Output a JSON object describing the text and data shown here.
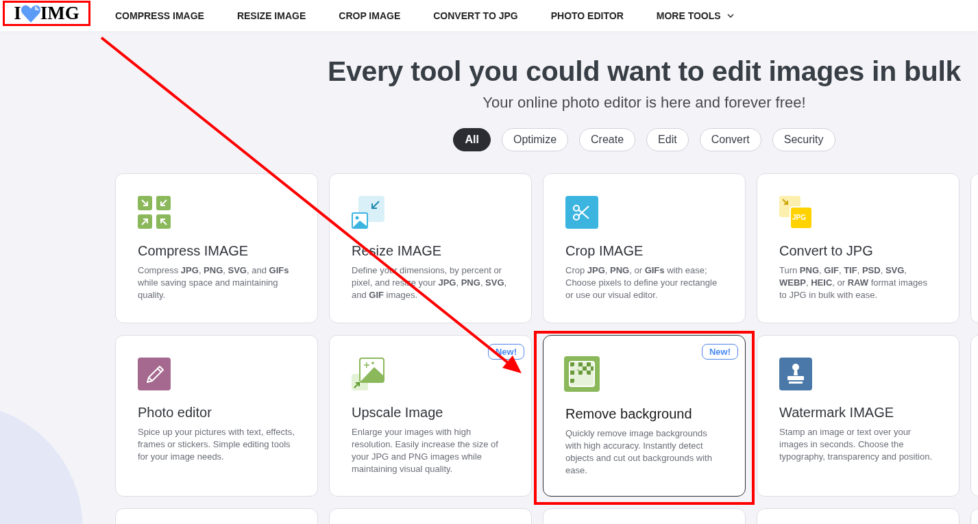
{
  "logo": {
    "left": "I",
    "right": "IMG",
    "annotated": true
  },
  "nav": [
    {
      "label": "COMPRESS IMAGE",
      "dropdown": false
    },
    {
      "label": "RESIZE IMAGE",
      "dropdown": false
    },
    {
      "label": "CROP IMAGE",
      "dropdown": false
    },
    {
      "label": "CONVERT TO JPG",
      "dropdown": false
    },
    {
      "label": "PHOTO EDITOR",
      "dropdown": false
    },
    {
      "label": "MORE TOOLS",
      "dropdown": true
    }
  ],
  "heading": "Every tool you could want to edit images in bulk",
  "subtitle": "Your online photo editor is here and forever free!",
  "filters": [
    {
      "label": "All",
      "selected": true
    },
    {
      "label": "Optimize",
      "selected": false
    },
    {
      "label": "Create",
      "selected": false
    },
    {
      "label": "Edit",
      "selected": false
    },
    {
      "label": "Convert",
      "selected": false
    },
    {
      "label": "Security",
      "selected": false
    }
  ],
  "tools": [
    {
      "kind": "compress",
      "title": "Compress IMAGE",
      "description": "Compress **JPG**, **PNG**, **SVG**, and **GIFs** while saving space and maintaining quality.",
      "hovered": false,
      "annotated": false
    },
    {
      "kind": "resize",
      "title": "Resize IMAGE",
      "description": "Define your dimensions, by percent or pixel, and resize your **JPG**, **PNG**, **SVG**, and **GIF** images.",
      "hovered": false,
      "annotated": false
    },
    {
      "kind": "crop",
      "title": "Crop IMAGE",
      "description": "Crop **JPG**, **PNG**, or **GIFs** with ease; Choose pixels to define your rectangle or use our visual editor.",
      "hovered": false,
      "annotated": false
    },
    {
      "kind": "convert",
      "icon_text": "JPG",
      "title": "Convert to JPG",
      "description": "Turn **PNG**, **GIF**, **TIF**, **PSD**, **SVG**, **WEBP**, **HEIC**, or **RAW** format images to JPG in bulk with ease.",
      "hovered": false,
      "annotated": false
    },
    {
      "kind": "edit",
      "title": "Photo editor",
      "description": "Spice up your pictures with text, effects, frames or stickers. Simple editing tools for your image needs.",
      "hovered": false,
      "annotated": false
    },
    {
      "kind": "upscale",
      "badge": "New!",
      "title": "Upscale Image",
      "description": "Enlarge your images with high resolution. Easily increase the size of your JPG and PNG images while maintaining visual quality.",
      "hovered": false,
      "annotated": false
    },
    {
      "kind": "remove-bg",
      "badge": "New!",
      "title": "Remove background",
      "description": "Quickly remove image backgrounds with high accuracy. Instantly detect objects and cut out backgrounds with ease.",
      "hovered": true,
      "annotated": true
    },
    {
      "kind": "watermark",
      "title": "Watermark IMAGE",
      "description": "Stamp an image or text over your images in seconds. Choose the typography, transparency and position.",
      "hovered": false,
      "annotated": false
    }
  ],
  "annotation_arrow": true
}
